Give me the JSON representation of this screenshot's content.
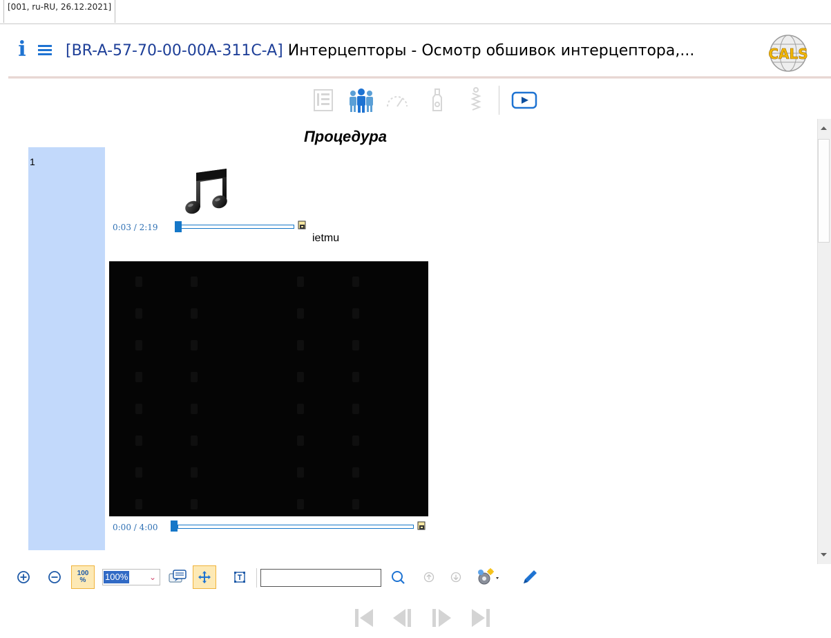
{
  "tab": {
    "label": "[001, ru-RU, 26.12.2021]"
  },
  "header": {
    "doc_code": "[BR-A-57-70-00-00A-311C-A]",
    "doc_title": " Интерцепторы - Осмотр обшивок интерцептора,..."
  },
  "content": {
    "section_title": "Процедура",
    "step_number": "1",
    "audio": {
      "time": "0:03 / 2:19",
      "caption": "ietmu",
      "progress": 0.02
    },
    "video": {
      "time": "0:00 / 4:00",
      "progress": 0.0
    }
  },
  "toolbar": {
    "zoom_value": "100%",
    "reset_zoom_label": "100 %",
    "search_value": ""
  },
  "colors": {
    "accent": "#1e73d2",
    "step_column": "#c2d9fb",
    "active_button": "#fde9b5",
    "active_border": "#f0b23a",
    "media_blue": "#1577c8"
  },
  "icons": {
    "view_toolbar": [
      "description-icon",
      "personnel-icon",
      "gauge-icon",
      "bottle-icon",
      "spring-icon",
      "play-icon"
    ],
    "bottom_toolbar": [
      "zoom-in-icon",
      "zoom-out-icon",
      "zoom-100-icon",
      "comment-icon",
      "pan-icon",
      "text-select-icon",
      "search-icon",
      "arrow-up-icon",
      "arrow-down-icon",
      "settings-icon",
      "pen-icon"
    ],
    "navigation": [
      "first-page-icon",
      "previous-page-icon",
      "next-page-icon",
      "last-page-icon"
    ]
  }
}
